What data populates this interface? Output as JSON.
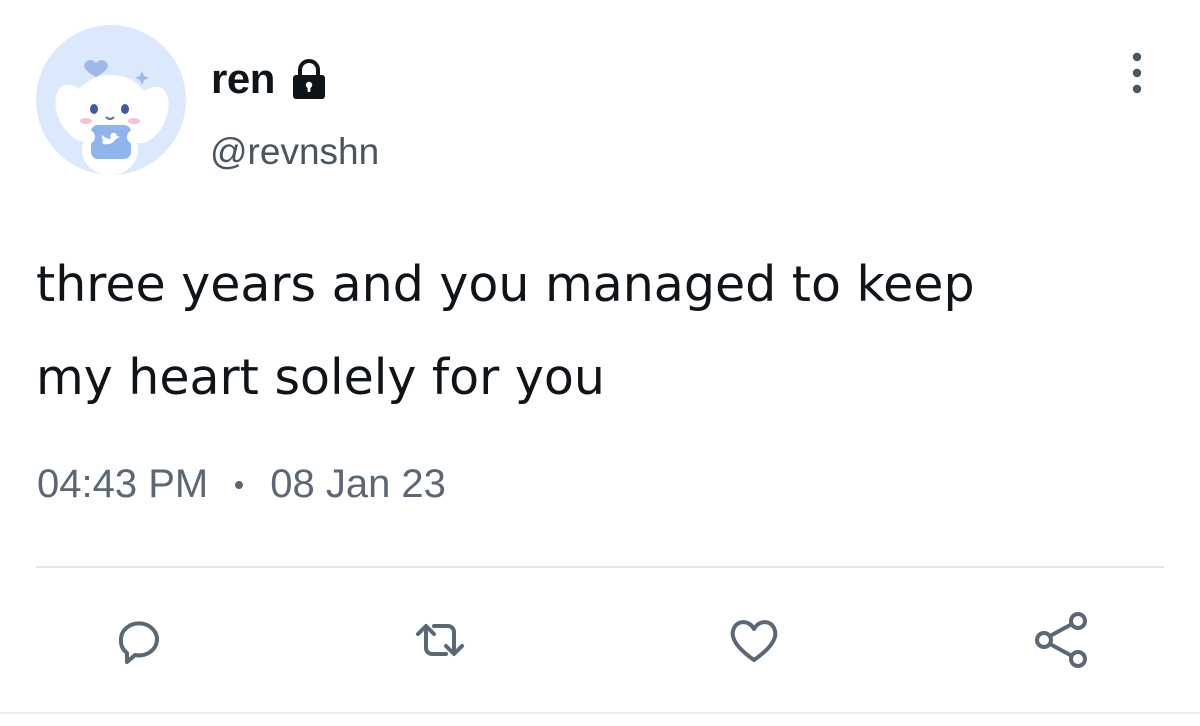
{
  "user": {
    "display_name": "ren",
    "handle": "@revnshn",
    "avatar_icon": "cinnamoroll-avatar",
    "verified_icon": "lock-icon"
  },
  "tweet": {
    "text_line1": "three years and you managed to keep",
    "text_line2": "my heart solely for you",
    "time": "04:43 PM",
    "date": "08 Jan 23"
  },
  "actions": [
    {
      "name": "reply",
      "icon": "reply-icon"
    },
    {
      "name": "retweet",
      "icon": "retweet-icon"
    },
    {
      "name": "like",
      "icon": "heart-icon"
    },
    {
      "name": "share",
      "icon": "share-icon"
    }
  ],
  "colors": {
    "text": "#0f1419",
    "secondary": "#5b6775",
    "divider": "#e3e7eb",
    "avatar_bg": "#dce8fb"
  }
}
